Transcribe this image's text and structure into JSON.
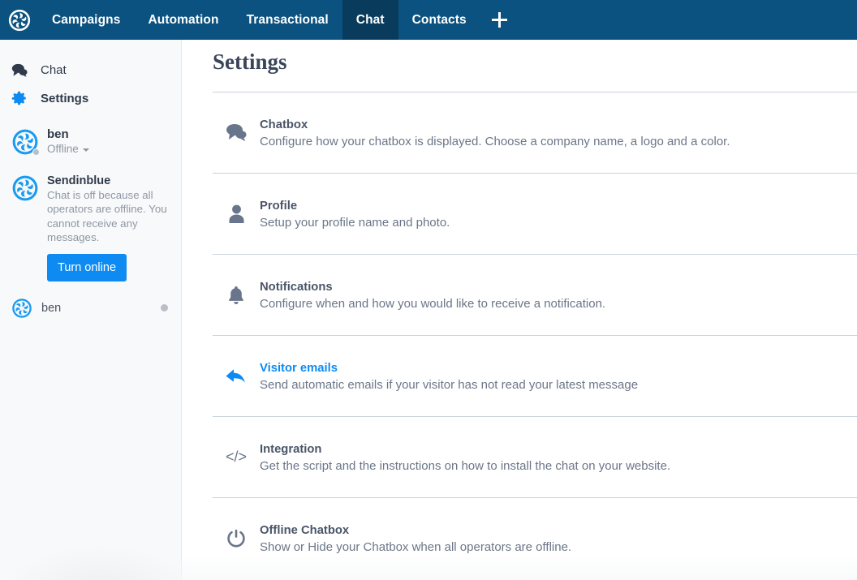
{
  "topnav": {
    "logo_icon": "sendinblue-pinwheel-logo",
    "brand_color": "#0b5280",
    "active_color": "#083b5c",
    "items": [
      {
        "label": "Campaigns",
        "active": false
      },
      {
        "label": "Automation",
        "active": false
      },
      {
        "label": "Transactional",
        "active": false
      },
      {
        "label": "Chat",
        "active": true
      },
      {
        "label": "Contacts",
        "active": false
      }
    ],
    "add_icon": "plus-icon"
  },
  "sidebar": {
    "nav": [
      {
        "label": "Chat",
        "icon": "chat-bubbles-icon",
        "active": false
      },
      {
        "label": "Settings",
        "icon": "gear-icon",
        "active": true
      }
    ],
    "operator": {
      "avatar_icon": "sendinblue-pinwheel-avatar",
      "name": "ben",
      "status": "Offline",
      "status_dot_color": "#b9bfc7"
    },
    "notice": {
      "avatar_icon": "sendinblue-pinwheel-avatar",
      "title": "Sendinblue",
      "text": "Chat is off because all operators are offline. You cannot receive any messages.",
      "button_label": "Turn online",
      "button_color": "#0d8bf2"
    },
    "operator_list": [
      {
        "name": "ben",
        "avatar_icon": "sendinblue-pinwheel-avatar",
        "status_dot_color": "#b9bfc7"
      }
    ]
  },
  "main": {
    "title": "Settings",
    "settings": [
      {
        "icon": "chat-bubbles-icon",
        "name": "Chatbox",
        "desc": "Configure how your chatbox is displayed. Choose a company name, a logo and a color.",
        "highlighted": false
      },
      {
        "icon": "person-icon",
        "name": "Profile",
        "desc": "Setup your profile name and photo.",
        "highlighted": false
      },
      {
        "icon": "bell-icon",
        "name": "Notifications",
        "desc": "Configure when and how you would like to receive a notification.",
        "highlighted": false
      },
      {
        "icon": "reply-arrow-icon",
        "name": "Visitor emails",
        "desc": "Send automatic emails if your visitor has not read your latest message",
        "highlighted": true
      },
      {
        "icon": "code-brackets-icon",
        "name": "Integration",
        "desc": "Get the script and the instructions on how to install the chat on your website.",
        "highlighted": false
      },
      {
        "icon": "power-icon",
        "name": "Offline Chatbox",
        "desc": "Show or Hide your Chatbox when all operators are offline.",
        "highlighted": false
      }
    ]
  },
  "colors": {
    "nav_bg": "#0b5280",
    "nav_active_bg": "#083b5c",
    "accent_blue": "#0d8bf2",
    "icon_slate": "#68758a",
    "text_dark": "#4a5568",
    "text_muted": "#6b7687",
    "sidebar_bg": "#f8f9fa",
    "divider": "#c9d2dc"
  }
}
